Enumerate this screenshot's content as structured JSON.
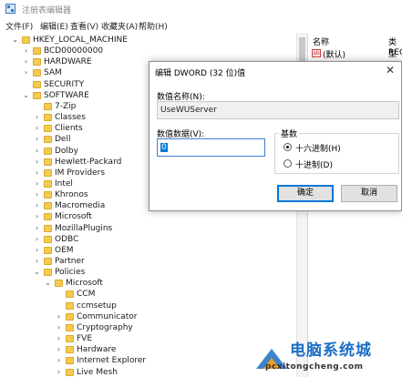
{
  "window": {
    "title": "注册表编辑器"
  },
  "menu": [
    "文件(F)",
    "编辑(E)",
    "查看(V)",
    "收藏夹(A)",
    "帮助(H)"
  ],
  "tree": [
    {
      "label": "HKEY_LOCAL_MACHINE",
      "expander": "v"
    },
    {
      "label": "BCD00000000",
      "expander": ">"
    },
    {
      "label": "HARDWARE",
      "expander": ">"
    },
    {
      "label": "SAM",
      "expander": ">"
    },
    {
      "label": "SECURITY",
      "expander": ""
    },
    {
      "label": "SOFTWARE",
      "expander": "v"
    },
    {
      "label": "7-Zip",
      "expander": ""
    },
    {
      "label": "Classes",
      "expander": ">"
    },
    {
      "label": "Clients",
      "expander": ">"
    },
    {
      "label": "Dell",
      "expander": ">"
    },
    {
      "label": "Dolby",
      "expander": ">"
    },
    {
      "label": "Hewlett-Packard",
      "expander": ">"
    },
    {
      "label": "IM Providers",
      "expander": ">"
    },
    {
      "label": "Intel",
      "expander": ">"
    },
    {
      "label": "Khronos",
      "expander": ">"
    },
    {
      "label": "Macromedia",
      "expander": ">"
    },
    {
      "label": "Microsoft",
      "expander": ">"
    },
    {
      "label": "MozillaPlugins",
      "expander": ">"
    },
    {
      "label": "ODBC",
      "expander": ">"
    },
    {
      "label": "OEM",
      "expander": ">"
    },
    {
      "label": "Partner",
      "expander": ">"
    },
    {
      "label": "Policies",
      "expander": "v"
    },
    {
      "label": "Microsoft",
      "expander": "v"
    },
    {
      "label": "CCM",
      "expander": ""
    },
    {
      "label": "ccmsetup",
      "expander": ""
    },
    {
      "label": "Communicator",
      "expander": ">"
    },
    {
      "label": "Cryptography",
      "expander": ">"
    },
    {
      "label": "FVE",
      "expander": ">"
    },
    {
      "label": "Hardware",
      "expander": ">"
    },
    {
      "label": "Internet Explorer",
      "expander": ">"
    },
    {
      "label": "Live Mesh",
      "expander": ">"
    }
  ],
  "list": {
    "col_name": "名称",
    "col_type": "类型",
    "rows": [
      {
        "name": "(默认)",
        "type": "REG",
        "icon": "reg-string-icon"
      }
    ]
  },
  "dialog": {
    "title": "编辑 DWORD (32 位)值",
    "name_label": "数值名称(N):",
    "name_value": "UseWUServer",
    "data_label": "数值数据(V):",
    "data_value": "0",
    "base_label": "基数",
    "hex_label": "十六进制(H)",
    "dec_label": "十进制(D)",
    "hex_selected": true,
    "ok_label": "确定",
    "cancel_label": "取消"
  },
  "watermark": {
    "title": "电脑系统城",
    "url": "pcxitongcheng.com"
  },
  "colors": {
    "folder": "#f3cc4f",
    "selection": "#0078d7",
    "watermark": "#1c6ec4"
  }
}
